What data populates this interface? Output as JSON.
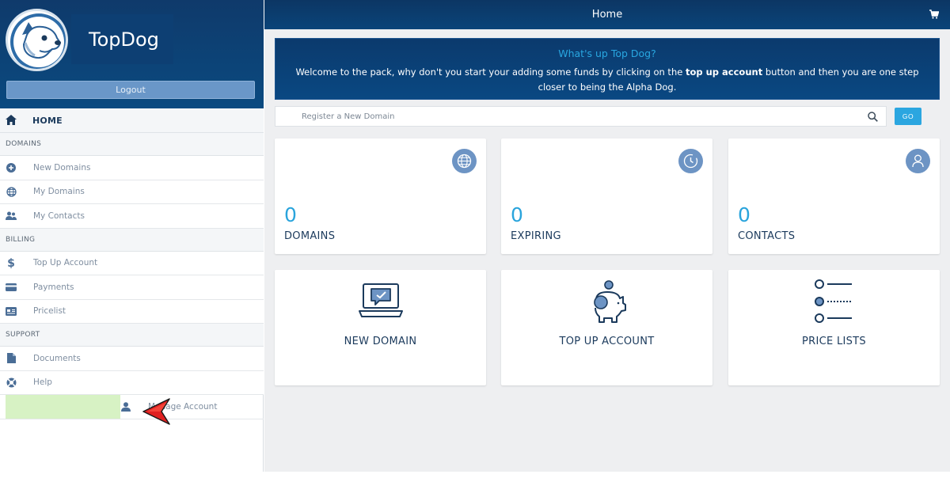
{
  "brand": {
    "name": "TopDog"
  },
  "sidebar": {
    "logout_label": "Logout",
    "home_label": "HOME",
    "sections": {
      "domains": "DOMAINS",
      "billing": "BILLING",
      "support": "SUPPORT"
    },
    "items": {
      "new_domains": "New Domains",
      "my_domains": "My Domains",
      "my_contacts": "My Contacts",
      "top_up_account": "Top Up Account",
      "payments": "Payments",
      "pricelist": "Pricelist",
      "documents": "Documents",
      "help": "Help",
      "manage_account": "Manage Account"
    }
  },
  "header": {
    "title": "Home"
  },
  "welcome": {
    "title": "What's up Top Dog?",
    "text_before": "Welcome to the pack, why don't you start your adding some funds by clicking on the ",
    "text_bold": "top up account",
    "text_after": " button and then you are one step closer to being the Alpha Dog."
  },
  "search": {
    "placeholder": "Register a New Domain",
    "value": "",
    "go_label": "GO"
  },
  "stats": {
    "domains": {
      "value": "0",
      "label": "DOMAINS"
    },
    "expiring": {
      "value": "0",
      "label": "EXPIRING"
    },
    "contacts": {
      "value": "0",
      "label": "CONTACTS"
    }
  },
  "actions": {
    "new_domain": "NEW DOMAIN",
    "top_up_account": "TOP UP ACCOUNT",
    "price_lists": "PRICE LISTS"
  },
  "colors": {
    "header_navy": "#0b3a6d",
    "accent_blue": "#2aa4dc",
    "label_navy": "#1b3a5c",
    "highlight_green": "#d7f2c4",
    "pointer_red": "#e02020"
  }
}
